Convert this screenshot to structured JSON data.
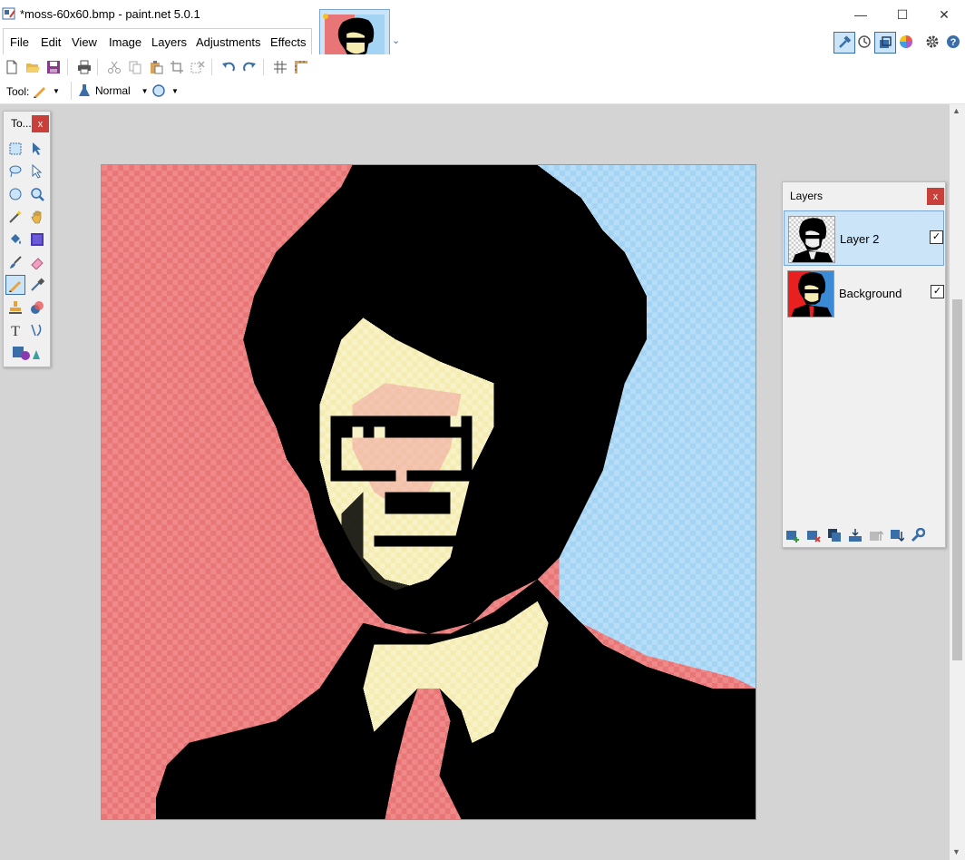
{
  "window": {
    "title": "*moss-60x60.bmp - paint.net 5.0.1",
    "minimize": "—",
    "maximize": "☐",
    "close": "✕"
  },
  "menu": {
    "items": [
      "File",
      "Edit",
      "View",
      "Image",
      "Layers",
      "Adjustments",
      "Effects"
    ]
  },
  "tool_options": {
    "tool_label": "Tool:",
    "blend_mode": "Normal"
  },
  "tools_window": {
    "title": "To...",
    "close": "x"
  },
  "layers_window": {
    "title": "Layers",
    "close": "x",
    "layers": [
      {
        "name": "Layer 2",
        "visible": true,
        "selected": true
      },
      {
        "name": "Background",
        "visible": true,
        "selected": false
      }
    ]
  },
  "colors": {
    "accent": "#3a6ea8",
    "selection": "#cce4f7",
    "bg_red": "#e87676",
    "bg_blue": "#a4d4f4",
    "skin": "#f4ecb0",
    "ink": "#000000",
    "close_red": "#c9403b"
  }
}
